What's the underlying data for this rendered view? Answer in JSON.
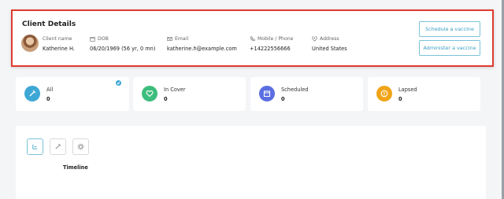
{
  "client": {
    "title": "Client Details",
    "name_label": "Client name",
    "name": "Katherine H.",
    "dob_label": "DOB",
    "dob": "06/20/1969 (56 yr, 0 mn)",
    "email_label": "Email",
    "email": "katherine.h@example.com",
    "phone_label": "Mobile / Phone",
    "phone": "+14222556666",
    "address_label": "Address",
    "address": "United States",
    "schedule_button": "Schedule a vaccine",
    "administer_button": "Administer a vaccine"
  },
  "stats": [
    {
      "label": "All",
      "count": "0",
      "color": "#3ea7d6",
      "icon": "syringe-icon",
      "selected": true
    },
    {
      "label": "In Cover",
      "count": "0",
      "color": "#3dbd7d",
      "icon": "heart-icon"
    },
    {
      "label": "Scheduled",
      "count": "0",
      "color": "#5b6ee1",
      "icon": "calendar-icon"
    },
    {
      "label": "Lapsed",
      "count": "0",
      "color": "#f0a417",
      "icon": "alert-icon"
    }
  ],
  "timeline": {
    "label": "Timeline",
    "tools": [
      "timeline-icon",
      "syringe-icon",
      "gear-icon"
    ]
  },
  "colors": {
    "highlight_border": "#e03a2f",
    "accent": "#3aa0c4"
  }
}
